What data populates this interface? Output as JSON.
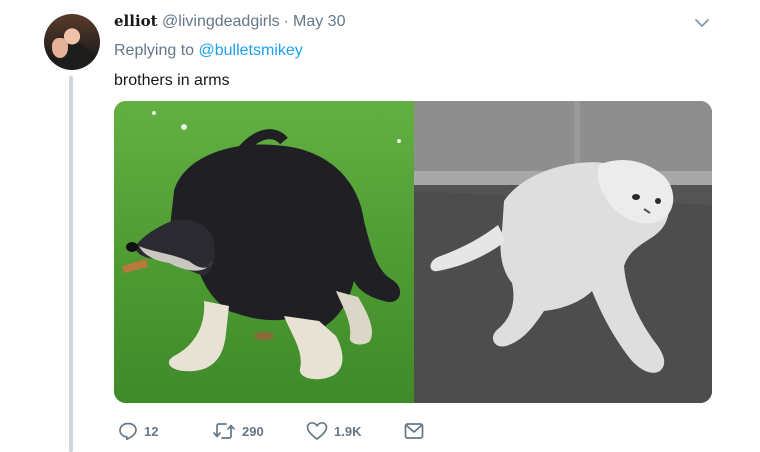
{
  "tweet": {
    "display_name": "elliot",
    "handle": "@livingdeadgirls",
    "separator": "·",
    "date": "May 30",
    "replying_prefix": "Replying to",
    "replying_to": "@bulletsmikey",
    "text": "brothers in arms"
  },
  "media": {
    "photos": [
      {
        "subject": "dog"
      },
      {
        "subject": "cat"
      }
    ]
  },
  "actions": {
    "replies": "12",
    "retweets": "290",
    "likes": "1.9K"
  },
  "colors": {
    "link": "#1da1f2",
    "muted": "#657786",
    "thread_line": "#ccd6dd",
    "grass": "#4e9a33",
    "asphalt": "#545454"
  },
  "icons": [
    "chevron-down-icon",
    "reply-icon",
    "retweet-icon",
    "heart-icon",
    "mail-icon"
  ]
}
